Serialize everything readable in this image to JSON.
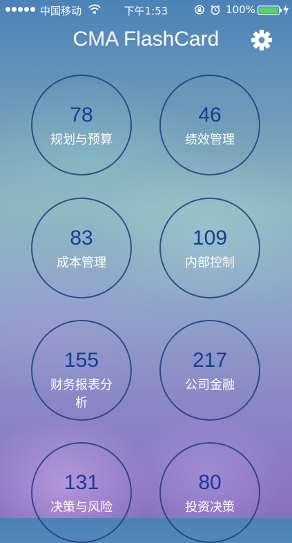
{
  "status_bar": {
    "carrier": "中国移动",
    "time": "下午1:53",
    "battery": "100%"
  },
  "header": {
    "title": "CMA FlashCard",
    "settings_icon": "gear-icon"
  },
  "categories": [
    {
      "count": "78",
      "label": "规划与预算"
    },
    {
      "count": "46",
      "label": "绩效管理"
    },
    {
      "count": "83",
      "label": "成本管理"
    },
    {
      "count": "109",
      "label": "内部控制"
    },
    {
      "count": "155",
      "label": "财务报表分析"
    },
    {
      "count": "217",
      "label": "公司金融"
    },
    {
      "count": "131",
      "label": "决策与风险"
    },
    {
      "count": "80",
      "label": "投资决策"
    }
  ],
  "colors": {
    "count_text": "#153e98",
    "circle_border": "#1c4080",
    "label_text": "#ffffff"
  }
}
